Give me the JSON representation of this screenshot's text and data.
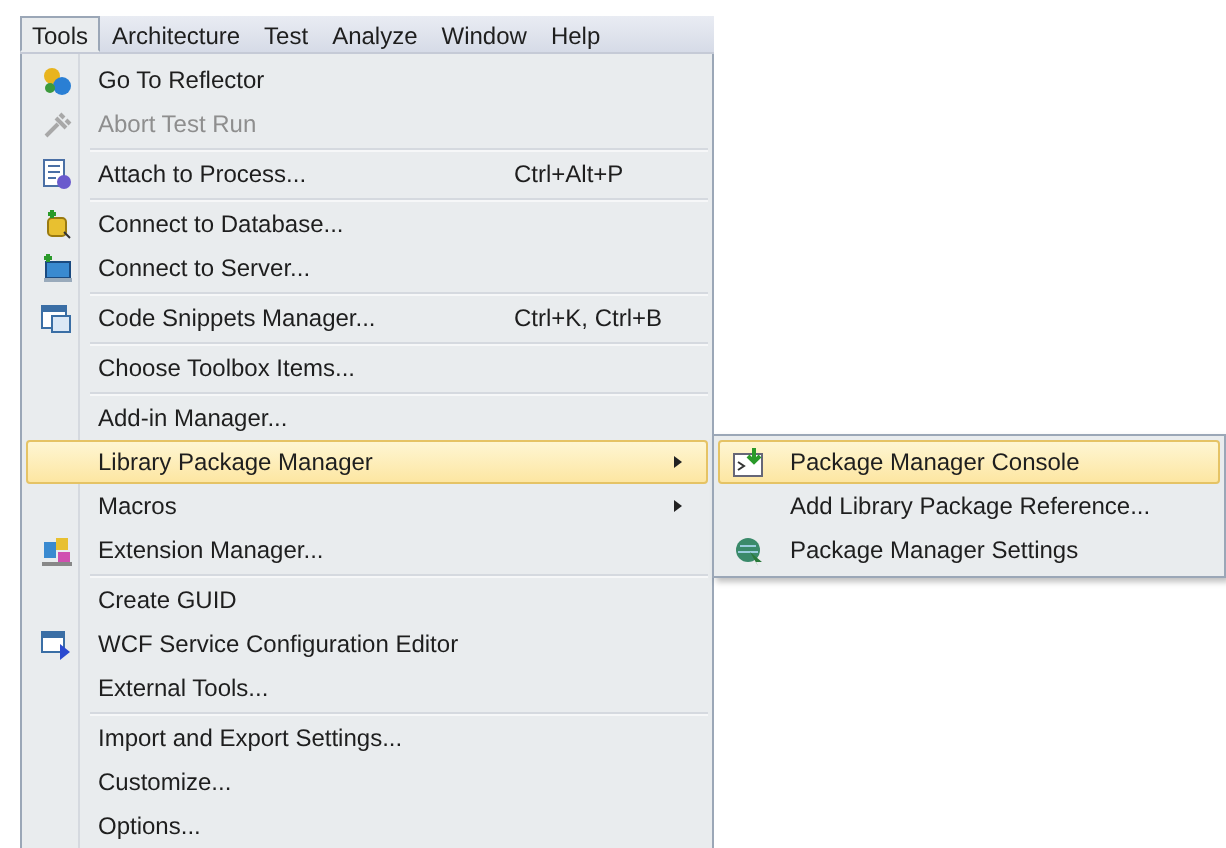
{
  "menubar": [
    {
      "label": "Tools",
      "selected": true
    },
    {
      "label": "Architecture",
      "selected": false
    },
    {
      "label": "Test",
      "selected": false
    },
    {
      "label": "Analyze",
      "selected": false
    },
    {
      "label": "Window",
      "selected": false
    },
    {
      "label": "Help",
      "selected": false
    }
  ],
  "menu": [
    {
      "kind": "item",
      "label": "Go To Reflector",
      "disabled": false,
      "selected": false
    },
    {
      "kind": "item",
      "label": "Abort Test Run",
      "disabled": true,
      "selected": false
    },
    {
      "kind": "separator"
    },
    {
      "kind": "item",
      "label": "Attach to Process...",
      "shortcut": "Ctrl+Alt+P",
      "disabled": false,
      "selected": false
    },
    {
      "kind": "separator"
    },
    {
      "kind": "item",
      "label": "Connect to Database...",
      "disabled": false,
      "selected": false
    },
    {
      "kind": "item",
      "label": "Connect to Server...",
      "disabled": false,
      "selected": false
    },
    {
      "kind": "separator"
    },
    {
      "kind": "item",
      "label": "Code Snippets Manager...",
      "shortcut": "Ctrl+K, Ctrl+B",
      "disabled": false,
      "selected": false
    },
    {
      "kind": "separator"
    },
    {
      "kind": "item",
      "label": "Choose Toolbox Items...",
      "disabled": false,
      "selected": false
    },
    {
      "kind": "separator"
    },
    {
      "kind": "item",
      "label": "Add-in Manager...",
      "disabled": false,
      "selected": false
    },
    {
      "kind": "item",
      "label": "Library Package Manager",
      "submenu": true,
      "disabled": false,
      "selected": true
    },
    {
      "kind": "item",
      "label": "Macros",
      "submenu": true,
      "disabled": false,
      "selected": false
    },
    {
      "kind": "item",
      "label": "Extension Manager...",
      "disabled": false,
      "selected": false
    },
    {
      "kind": "separator"
    },
    {
      "kind": "item",
      "label": "Create GUID",
      "disabled": false,
      "selected": false
    },
    {
      "kind": "item",
      "label": "WCF Service Configuration Editor",
      "disabled": false,
      "selected": false
    },
    {
      "kind": "item",
      "label": "External Tools...",
      "disabled": false,
      "selected": false
    },
    {
      "kind": "separator"
    },
    {
      "kind": "item",
      "label": "Import and Export Settings...",
      "disabled": false,
      "selected": false
    },
    {
      "kind": "item",
      "label": "Customize...",
      "disabled": false,
      "selected": false
    },
    {
      "kind": "item",
      "label": "Options...",
      "disabled": false,
      "selected": false
    }
  ],
  "submenu": [
    {
      "label": "Package Manager Console",
      "selected": true
    },
    {
      "label": "Add Library Package Reference...",
      "selected": false
    },
    {
      "label": "Package Manager Settings",
      "selected": false
    }
  ]
}
